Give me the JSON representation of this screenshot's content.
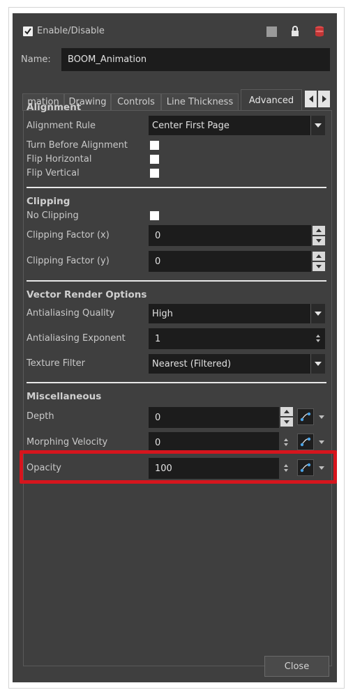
{
  "header": {
    "enable_label": "Enable/Disable",
    "enable_checked": true,
    "name_label": "Name:",
    "name_value": "BOOM_Animation"
  },
  "tabs": [
    {
      "label": "mation"
    },
    {
      "label": "Drawing"
    },
    {
      "label": "Controls"
    },
    {
      "label": "Line Thickness"
    },
    {
      "label": "Advanced"
    }
  ],
  "alignment": {
    "title": "Alignment",
    "rule_label": "Alignment Rule",
    "rule_value": "Center First Page",
    "turn_label": "Turn Before Alignment",
    "flip_h_label": "Flip Horizontal",
    "flip_v_label": "Flip Vertical"
  },
  "clipping": {
    "title": "Clipping",
    "no_clip_label": "No Clipping",
    "factor_x_label": "Clipping Factor (x)",
    "factor_x_value": "0",
    "factor_y_label": "Clipping Factor (y)",
    "factor_y_value": "0"
  },
  "vector": {
    "title": "Vector Render Options",
    "aa_quality_label": "Antialiasing Quality",
    "aa_quality_value": "High",
    "aa_exponent_label": "Antialiasing Exponent",
    "aa_exponent_value": "1",
    "texture_label": "Texture Filter",
    "texture_value": "Nearest (Filtered)"
  },
  "misc": {
    "title": "Miscellaneous",
    "depth_label": "Depth",
    "depth_value": "0",
    "morph_label": "Morphing Velocity",
    "morph_value": "0",
    "opacity_label": "Opacity",
    "opacity_value": "100"
  },
  "footer": {
    "close_label": "Close"
  },
  "colors": {
    "panel_bg": "#3f3f3f",
    "field_bg": "#1c1c1c",
    "highlight": "#d6151d",
    "function_icon_blue": "#4aa3e6"
  }
}
